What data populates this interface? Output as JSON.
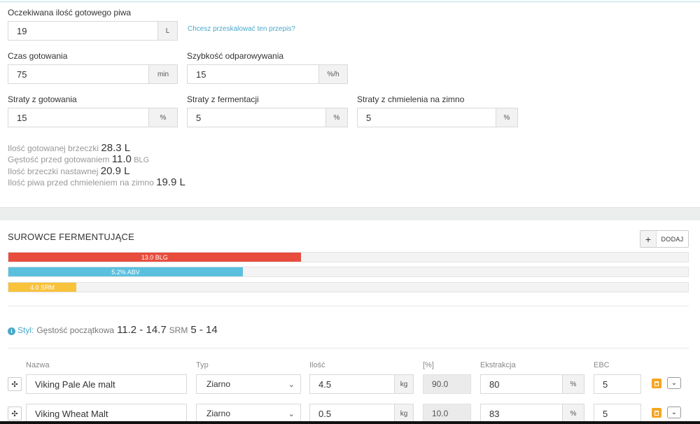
{
  "scaling": {
    "expected_volume": {
      "label": "Oczekiwana ilość gotowego piwa",
      "value": "19",
      "unit": "L"
    },
    "rescale_link": "Chcesz przeskalować ten przepis?",
    "boil_time": {
      "label": "Czas gotowania",
      "value": "75",
      "unit": "min"
    },
    "evaporation": {
      "label": "Szybkość odparowywania",
      "value": "15",
      "unit": "%/h"
    },
    "boil_loss": {
      "label": "Straty z gotowania",
      "value": "15",
      "unit": "%"
    },
    "fermentation_loss": {
      "label": "Straty z fermentacji",
      "value": "5",
      "unit": "%"
    },
    "dryhop_loss": {
      "label": "Straty z chmielenia na zimno",
      "value": "5",
      "unit": "%"
    }
  },
  "stats": {
    "boiled_wort": {
      "label": "Ilość gotowanej brzeczki",
      "value": "28.3 L"
    },
    "pre_boil_gravity": {
      "label": "Gęstość przed gotowaniem",
      "value": "11.0",
      "unit": "BLG"
    },
    "pitched_wort": {
      "label": "Ilość brzeczki nastawnej",
      "value": "20.9 L"
    },
    "pre_dryhop_beer": {
      "label": "Ilość piwa przed chmieleniem na zimno",
      "value": "19.9 L"
    }
  },
  "fermentables": {
    "title": "SUROWCE FERMENTUJĄCE",
    "add_icon": "+",
    "add_label": "DODAJ",
    "bars": [
      {
        "label": "13.0 BLG",
        "fraction": 0.43,
        "color": "#e84c3d"
      },
      {
        "label": "5.2% ABV",
        "fraction": 0.345,
        "color": "#5bc0de"
      },
      {
        "label": "4.0 SRM",
        "fraction": 0.1,
        "color": "#f8c23a"
      }
    ],
    "style": {
      "icon": "i",
      "label": "Styl:",
      "gravity_label": "Gęstość początkowa",
      "gravity_range": "11.2 - 14.7",
      "srm_label": "SRM",
      "srm_range": "5 - 14"
    },
    "columns": {
      "name": "Nazwa",
      "type": "Typ",
      "amount": "Ilość",
      "percent": "[%]",
      "extraction": "Ekstrakcja",
      "ebc": "EBC"
    },
    "rows": [
      {
        "drag_icon": "✣",
        "name": "Viking Pale Ale malt",
        "type": "Ziarno",
        "amount": "4.5",
        "amount_unit": "kg",
        "percent": "90.0",
        "extraction": "80",
        "extraction_unit": "%",
        "ebc": "5",
        "chevron": "⌄"
      },
      {
        "drag_icon": "✣",
        "name": "Viking Wheat Malt",
        "type": "Ziarno",
        "amount": "0.5",
        "amount_unit": "kg",
        "percent": "10.0",
        "extraction": "83",
        "extraction_unit": "%",
        "ebc": "5",
        "chevron": "⌄"
      }
    ],
    "select_chevron": "⌄"
  }
}
